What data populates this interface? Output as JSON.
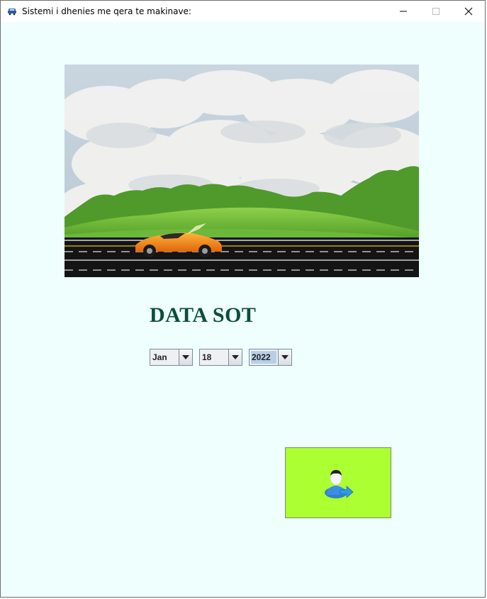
{
  "window": {
    "title": "Sistemi i dhenies me qera te makinave:",
    "app_icon": "car-icon",
    "controls": [
      "minimize-icon",
      "maximize-icon",
      "close-icon"
    ]
  },
  "banner": {
    "description_icon": "car-road-banner"
  },
  "heading": {
    "text": "DATA SOT",
    "color": "#0b4f37"
  },
  "date_picker": {
    "month": "Jan",
    "day": "18",
    "year": "2022"
  },
  "login_button": {
    "icon": "user-login-icon",
    "background": "#acff30"
  }
}
